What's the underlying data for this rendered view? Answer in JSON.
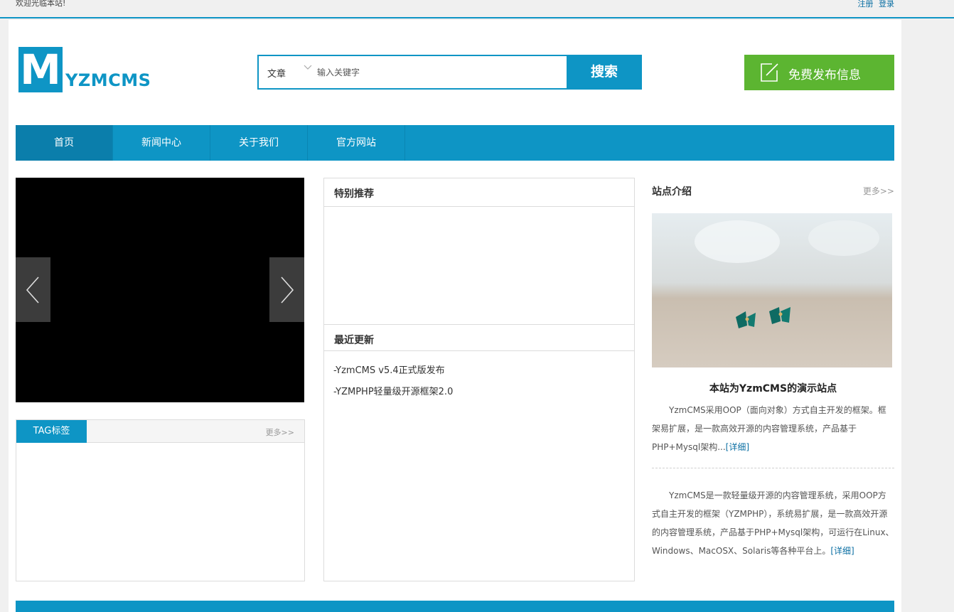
{
  "topbar": {
    "welcome": "欢迎光临本站!",
    "register": "注册",
    "login": "登录"
  },
  "logo": {
    "letter": "M",
    "text": "YZMCMS"
  },
  "search": {
    "category": "文章",
    "placeholder": "输入关键字",
    "button": "搜索"
  },
  "publish": {
    "label": "免费发布信息"
  },
  "nav": {
    "items": [
      {
        "label": "首页"
      },
      {
        "label": "新闻中心"
      },
      {
        "label": "关于我们"
      },
      {
        "label": "官方网站"
      }
    ]
  },
  "tag_box": {
    "tab": "TAG标签",
    "more": "更多>>"
  },
  "featured": {
    "title": "特别推荐"
  },
  "latest": {
    "title": "最近更新",
    "items": [
      "-YzmCMS v5.4正式版发布",
      "-YZMPHP轻量级开源框架2.0"
    ]
  },
  "site_intro": {
    "title": "站点介绍",
    "more": "更多>>",
    "headline": "本站为YzmCMS的演示站点",
    "para1": "YzmCMS采用OOP（面向对象）方式自主开发的框架。框架易扩展，是一款高效开源的内容管理系统，产品基于PHP+Mysql架构...",
    "para2": "YzmCMS是一款轻量级开源的内容管理系统，采用OOP方式自主开发的框架（YZMPHP），系统易扩展，是一款高效开源的内容管理系统，产品基于PHP+Mysql架构，可运行在Linux、Windows、MacOSX、Solaris等各种平台上。",
    "detail_link": "[详细]"
  },
  "colors": {
    "brand_blue": "#0e95c5",
    "publish_green": "#5cb531"
  },
  "icons": {
    "caret": "chevron-down-icon",
    "publish": "edit-icon",
    "prev": "chevron-left-icon",
    "next": "chevron-right-icon"
  }
}
